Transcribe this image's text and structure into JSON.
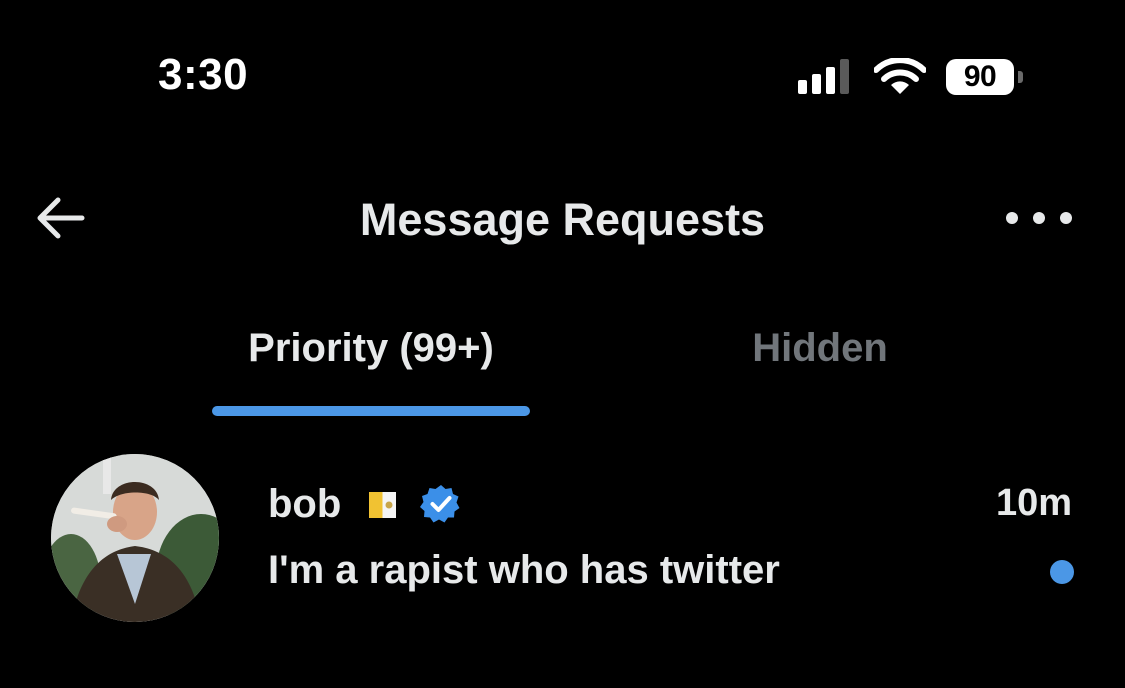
{
  "status_bar": {
    "time": "3:30",
    "battery": "90",
    "icons": [
      "cellular-signal-icon",
      "wifi-icon",
      "battery-icon"
    ]
  },
  "header": {
    "title": "Message Requests",
    "back_icon": "arrow-left-icon",
    "more_icon": "more-horizontal-icon"
  },
  "tabs": [
    {
      "label": "Priority (99+)",
      "active": true
    },
    {
      "label": "Hidden",
      "active": false
    }
  ],
  "conversations": [
    {
      "name": "bob",
      "flag_icon": "vatican-flag-icon",
      "verified": true,
      "time": "10m",
      "preview": "I'm a rapist who has twitter",
      "unread": true
    }
  ],
  "colors": {
    "background": "#000000",
    "text_primary": "#e7e9ea",
    "text_secondary": "#71767b",
    "accent": "#4b97e6"
  }
}
